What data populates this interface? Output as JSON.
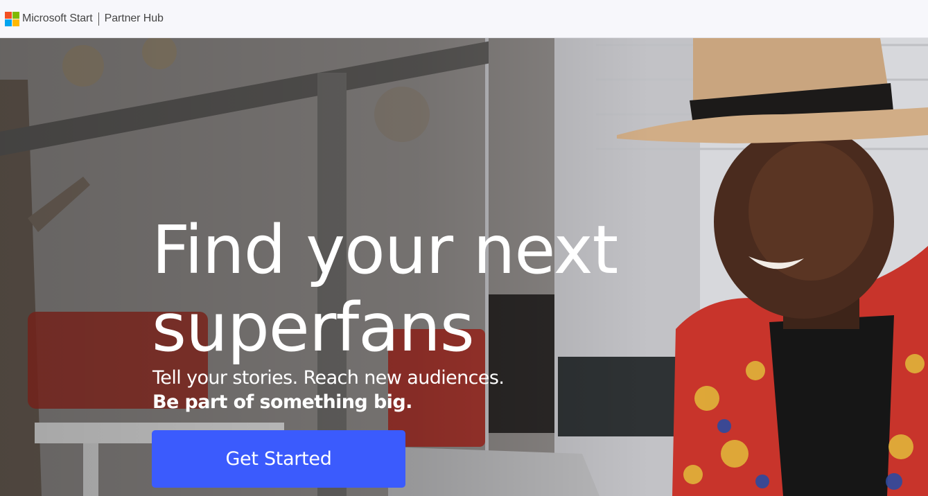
{
  "header": {
    "brand": "Microsoft Start",
    "section": "Partner Hub",
    "logo_colors": [
      "#f25022",
      "#7fba00",
      "#00a4ef",
      "#ffb900"
    ]
  },
  "hero": {
    "headline": "Find your next superfans",
    "tagline": "Tell your stories. Reach new audiences.",
    "tagline_bold": "Be part of something big.",
    "cta_label": "Get Started",
    "cta_color": "#3b5bfd",
    "image_description_icon": "person-smiling-hat-photo"
  }
}
